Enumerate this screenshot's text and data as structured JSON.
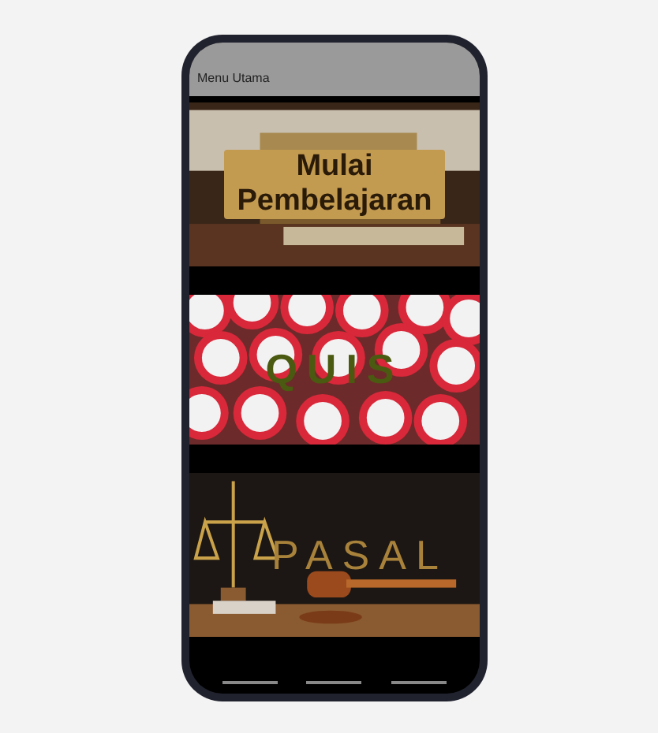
{
  "app_bar": {
    "title": "Menu Utama"
  },
  "menu": [
    {
      "kind": "books",
      "label": "Mulai Pembelajaran"
    },
    {
      "kind": "signs",
      "label": "QUIS"
    },
    {
      "kind": "law",
      "label": "PASAL"
    }
  ]
}
